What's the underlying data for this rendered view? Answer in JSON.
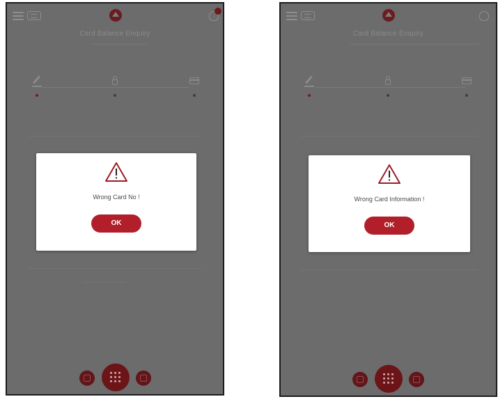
{
  "screens": [
    {
      "header": {
        "title": "Card Balance Enquiry",
        "menu_icon": "hamburger-menu-icon",
        "language_icon": "language-icon",
        "logo_icon": "bank-logo-icon",
        "notification_icon": "bell-icon"
      },
      "steps": [
        "pencil-icon",
        "lock-icon",
        "card-icon"
      ],
      "dialog": {
        "icon": "warning-icon",
        "message": "Wrong Card No !",
        "ok_label": "OK"
      },
      "bottom_nav": [
        "card-icon",
        "grid-menu-icon",
        "calendar-icon"
      ]
    },
    {
      "header": {
        "title": "Card Balance Enquiry",
        "menu_icon": "hamburger-menu-icon",
        "language_icon": "language-icon",
        "logo_icon": "bank-logo-icon",
        "notification_icon": "bell-icon"
      },
      "steps": [
        "pencil-icon",
        "lock-icon",
        "card-icon"
      ],
      "dialog": {
        "icon": "warning-icon",
        "message": "Wrong Card Information !",
        "ok_label": "OK"
      },
      "bottom_nav": [
        "card-icon",
        "grid-menu-icon",
        "calendar-icon"
      ]
    }
  ],
  "colors": {
    "overlay": "#6c6c6c",
    "accent": "#b21f2a",
    "dark_accent": "#6b1519",
    "warning_icon": "#9e1b26"
  }
}
